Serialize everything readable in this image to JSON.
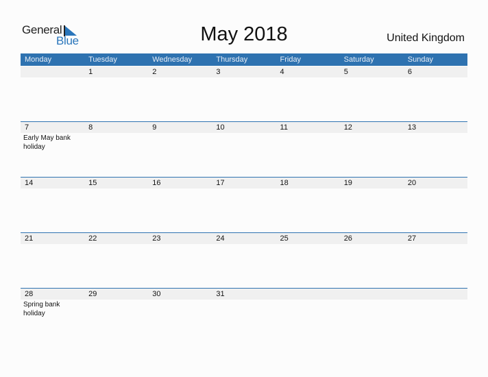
{
  "logo": {
    "word1": "General",
    "word2": "Blue",
    "icon": "triangle-flag-icon"
  },
  "title": "May 2018",
  "country": "United Kingdom",
  "colors": {
    "accent": "#2e72b0",
    "strip": "#f0f0f0"
  },
  "weekdays": [
    "Monday",
    "Tuesday",
    "Wednesday",
    "Thursday",
    "Friday",
    "Saturday",
    "Sunday"
  ],
  "weeks": [
    {
      "days": [
        {
          "num": "",
          "holiday": ""
        },
        {
          "num": "1",
          "holiday": ""
        },
        {
          "num": "2",
          "holiday": ""
        },
        {
          "num": "3",
          "holiday": ""
        },
        {
          "num": "4",
          "holiday": ""
        },
        {
          "num": "5",
          "holiday": ""
        },
        {
          "num": "6",
          "holiday": ""
        }
      ]
    },
    {
      "days": [
        {
          "num": "7",
          "holiday": "Early May bank holiday"
        },
        {
          "num": "8",
          "holiday": ""
        },
        {
          "num": "9",
          "holiday": ""
        },
        {
          "num": "10",
          "holiday": ""
        },
        {
          "num": "11",
          "holiday": ""
        },
        {
          "num": "12",
          "holiday": ""
        },
        {
          "num": "13",
          "holiday": ""
        }
      ]
    },
    {
      "days": [
        {
          "num": "14",
          "holiday": ""
        },
        {
          "num": "15",
          "holiday": ""
        },
        {
          "num": "16",
          "holiday": ""
        },
        {
          "num": "17",
          "holiday": ""
        },
        {
          "num": "18",
          "holiday": ""
        },
        {
          "num": "19",
          "holiday": ""
        },
        {
          "num": "20",
          "holiday": ""
        }
      ]
    },
    {
      "days": [
        {
          "num": "21",
          "holiday": ""
        },
        {
          "num": "22",
          "holiday": ""
        },
        {
          "num": "23",
          "holiday": ""
        },
        {
          "num": "24",
          "holiday": ""
        },
        {
          "num": "25",
          "holiday": ""
        },
        {
          "num": "26",
          "holiday": ""
        },
        {
          "num": "27",
          "holiday": ""
        }
      ]
    },
    {
      "days": [
        {
          "num": "28",
          "holiday": "Spring bank holiday"
        },
        {
          "num": "29",
          "holiday": ""
        },
        {
          "num": "30",
          "holiday": ""
        },
        {
          "num": "31",
          "holiday": ""
        },
        {
          "num": "",
          "holiday": ""
        },
        {
          "num": "",
          "holiday": ""
        },
        {
          "num": "",
          "holiday": ""
        }
      ]
    }
  ]
}
